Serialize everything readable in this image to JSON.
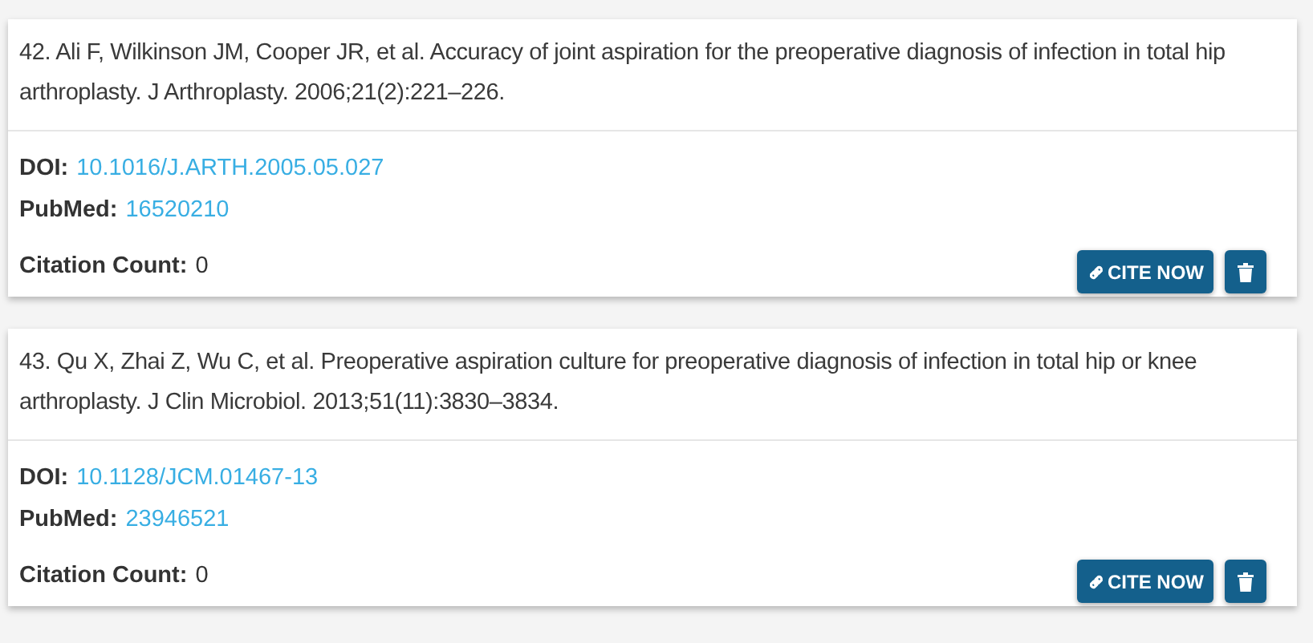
{
  "references": [
    {
      "citation": "42. Ali F, Wilkinson JM, Cooper JR, et al. Accuracy of joint aspiration for the preoperative diagnosis of infection in total hip arthroplasty. J Arthroplasty. 2006;21(2):221–226.",
      "doi_label": "DOI:",
      "doi": "10.1016/J.ARTH.2005.05.027",
      "pubmed_label": "PubMed:",
      "pubmed": "16520210",
      "citation_count_label": "Citation Count:",
      "citation_count": "0",
      "cite_button": "CITE NOW"
    },
    {
      "citation": "43. Qu X, Zhai Z, Wu C, et al. Preoperative aspiration culture for preoperative diagnosis of infection in total hip or knee arthroplasty. J Clin Microbiol. 2013;51(11):3830–3834.",
      "doi_label": "DOI:",
      "doi": "10.1128/JCM.01467-13",
      "pubmed_label": "PubMed:",
      "pubmed": "23946521",
      "citation_count_label": "Citation Count:",
      "citation_count": "0",
      "cite_button": "CITE NOW"
    }
  ]
}
